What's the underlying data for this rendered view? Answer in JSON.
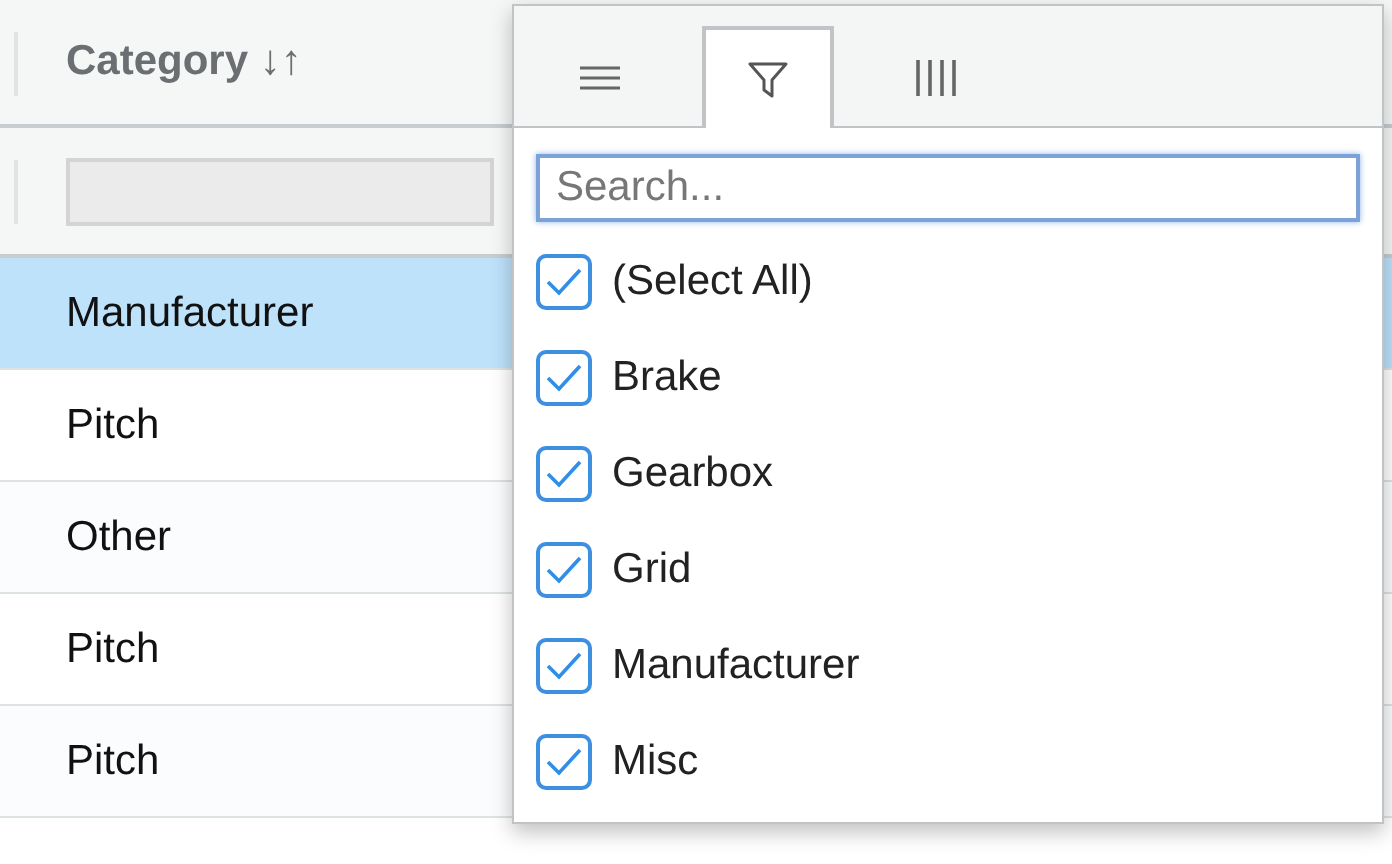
{
  "table": {
    "column": {
      "label": "Category",
      "sort_icon": "↓↑"
    },
    "rows": [
      {
        "category": "Manufacturer",
        "selected": true
      },
      {
        "category": "Pitch",
        "selected": false
      },
      {
        "category": "Other",
        "selected": false
      },
      {
        "category": "Pitch",
        "selected": false
      },
      {
        "category": "Pitch",
        "selected": false
      }
    ]
  },
  "filter_menu": {
    "tabs": [
      {
        "kind": "menu",
        "selected": false
      },
      {
        "kind": "filter",
        "selected": true
      },
      {
        "kind": "columns",
        "selected": false
      }
    ],
    "search": {
      "placeholder": "Search..."
    },
    "options": [
      {
        "label": "(Select All)",
        "checked": true
      },
      {
        "label": "Brake",
        "checked": true
      },
      {
        "label": "Gearbox",
        "checked": true
      },
      {
        "label": "Grid",
        "checked": true
      },
      {
        "label": "Manufacturer",
        "checked": true
      },
      {
        "label": "Misc",
        "checked": true
      }
    ]
  }
}
